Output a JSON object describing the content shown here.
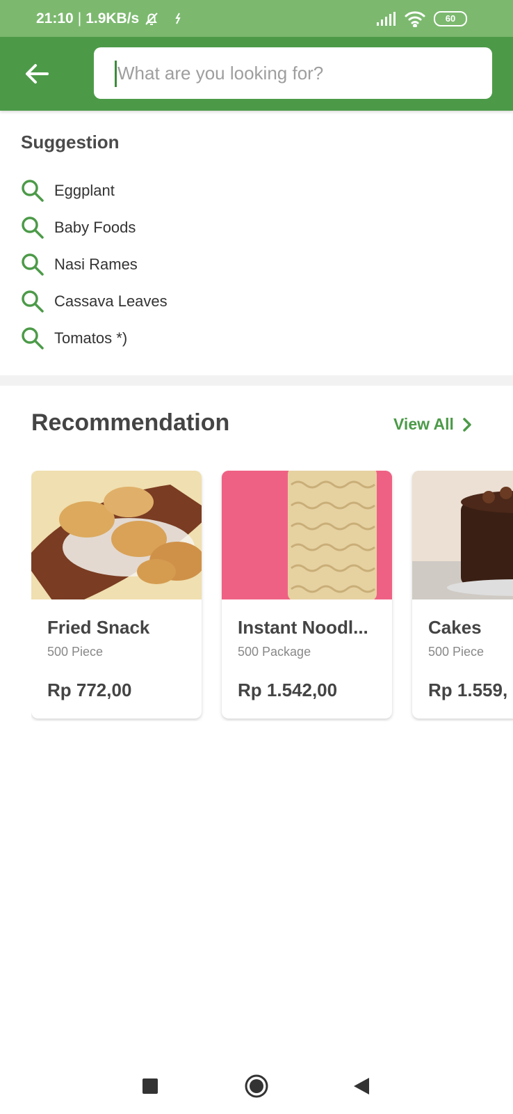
{
  "status_bar": {
    "time": "21:10",
    "separator": "|",
    "network_speed": "1.9KB/s",
    "battery": "60",
    "icons": [
      "bell-off-icon",
      "sync-icon",
      "signal-icon",
      "wifi-icon",
      "battery-icon"
    ]
  },
  "search": {
    "placeholder": "What are you looking for?",
    "value": ""
  },
  "suggestion": {
    "title": "Suggestion",
    "items": [
      {
        "label": "Eggplant"
      },
      {
        "label": "Baby Foods"
      },
      {
        "label": "Nasi Rames"
      },
      {
        "label": "Cassava Leaves"
      },
      {
        "label": "Tomatos *)"
      }
    ]
  },
  "recommendation": {
    "title": "Recommendation",
    "view_all": "View All",
    "products": [
      {
        "name": "Fried Snack",
        "unit": "500 Piece",
        "price": "Rp 772,00"
      },
      {
        "name": "Instant Noodl...",
        "unit": "500 Package",
        "price": "Rp 1.542,00"
      },
      {
        "name": "Cakes",
        "unit": "500 Piece",
        "price": "Rp 1.559,"
      }
    ]
  },
  "colors": {
    "status_bar": "#7cb96f",
    "app_bar": "#4c9a48",
    "accent": "#4c9a48"
  }
}
